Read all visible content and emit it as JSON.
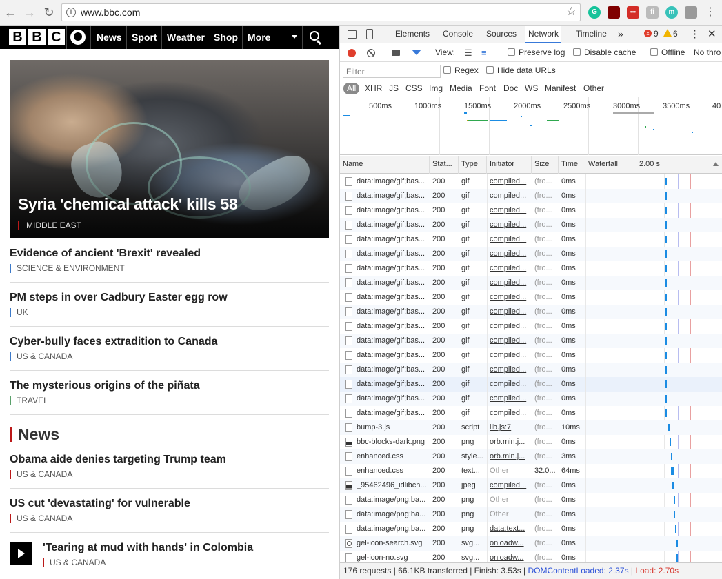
{
  "browser": {
    "url": "www.bbc.com",
    "extensions": [
      "grammarly-icon",
      "ublock-icon",
      "lastpass-icon",
      "extension-icon",
      "momentum-icon",
      "cube-icon"
    ],
    "ext_labels": [
      "G",
      "",
      "•••",
      "fi",
      "m",
      ""
    ]
  },
  "bbc": {
    "nav": [
      "News",
      "Sport",
      "Weather",
      "Shop",
      "More"
    ],
    "hero": {
      "title": "Syria 'chemical attack' kills 58",
      "tag": "MIDDLE EAST"
    },
    "stories": [
      {
        "title": "Evidence of ancient 'Brexit' revealed",
        "tag": "SCIENCE & ENVIRONMENT",
        "color": "#3d7ac9"
      },
      {
        "title": "PM steps in over Cadbury Easter egg row",
        "tag": "UK",
        "color": "#3d7ac9"
      },
      {
        "title": "Cyber-bully faces extradition to Canada",
        "tag": "US & CANADA",
        "color": "#3d7ac9"
      },
      {
        "title": "The mysterious origins of the piñata",
        "tag": "TRAVEL",
        "color": "#5aa06a"
      }
    ],
    "section": "News",
    "news_stories": [
      {
        "title": "Obama aide denies targeting Trump team",
        "tag": "US & CANADA"
      },
      {
        "title": "US cut 'devastating' for vulnerable",
        "tag": "US & CANADA"
      },
      {
        "title": "'Tearing at mud with hands' in Colombia",
        "tag": "US & CANADA"
      }
    ]
  },
  "devtools": {
    "tabs": [
      "Elements",
      "Console",
      "Sources",
      "Network",
      "Timeline"
    ],
    "active_tab": "Network",
    "more": "»",
    "errors": "9",
    "warnings": "6",
    "toolbar": {
      "view": "View:",
      "preserve_log": "Preserve log",
      "disable_cache": "Disable cache",
      "offline": "Offline",
      "throttle": "No thro"
    },
    "filter": {
      "placeholder": "Filter",
      "regex": "Regex",
      "hide_data_urls": "Hide data URLs"
    },
    "types": [
      "All",
      "XHR",
      "JS",
      "CSS",
      "Img",
      "Media",
      "Font",
      "Doc",
      "WS",
      "Manifest",
      "Other"
    ],
    "overview_ticks": [
      "500ms",
      "1000ms",
      "1500ms",
      "2000ms",
      "2500ms",
      "3000ms",
      "3500ms",
      "40"
    ],
    "columns": [
      "Name",
      "Stat...",
      "Type",
      "Initiator",
      "Size",
      "Time",
      "Waterfall",
      "2.00 s"
    ],
    "rows": [
      [
        "data:image/gif;bas...",
        "200",
        "gif",
        "compiled...",
        "(fro...",
        "0ms",
        "blank",
        0.58
      ],
      [
        "data:image/gif;bas...",
        "200",
        "gif",
        "compiled...",
        "(fro...",
        "0ms",
        "blank",
        0.58
      ],
      [
        "data:image/gif;bas...",
        "200",
        "gif",
        "compiled...",
        "(fro...",
        "0ms",
        "blank",
        0.58
      ],
      [
        "data:image/gif;bas...",
        "200",
        "gif",
        "compiled...",
        "(fro...",
        "0ms",
        "blank",
        0.58
      ],
      [
        "data:image/gif;bas...",
        "200",
        "gif",
        "compiled...",
        "(fro...",
        "0ms",
        "blank",
        0.58
      ],
      [
        "data:image/gif;bas...",
        "200",
        "gif",
        "compiled...",
        "(fro...",
        "0ms",
        "blank",
        0.58
      ],
      [
        "data:image/gif;bas...",
        "200",
        "gif",
        "compiled...",
        "(fro...",
        "0ms",
        "blank",
        0.58
      ],
      [
        "data:image/gif;bas...",
        "200",
        "gif",
        "compiled...",
        "(fro...",
        "0ms",
        "blank",
        0.58
      ],
      [
        "data:image/gif;bas...",
        "200",
        "gif",
        "compiled...",
        "(fro...",
        "0ms",
        "blank",
        0.58
      ],
      [
        "data:image/gif;bas...",
        "200",
        "gif",
        "compiled...",
        "(fro...",
        "0ms",
        "blank",
        0.58
      ],
      [
        "data:image/gif;bas...",
        "200",
        "gif",
        "compiled...",
        "(fro...",
        "0ms",
        "blank",
        0.58
      ],
      [
        "data:image/gif;bas...",
        "200",
        "gif",
        "compiled...",
        "(fro...",
        "0ms",
        "blank",
        0.58
      ],
      [
        "data:image/gif;bas...",
        "200",
        "gif",
        "compiled...",
        "(fro...",
        "0ms",
        "blank",
        0.58
      ],
      [
        "data:image/gif;bas...",
        "200",
        "gif",
        "compiled...",
        "(fro...",
        "0ms",
        "blank",
        0.58
      ],
      [
        "data:image/gif;bas...",
        "200",
        "gif",
        "compiled...",
        "(fro...",
        "0ms",
        "blank",
        0.58
      ],
      [
        "data:image/gif;bas...",
        "200",
        "gif",
        "compiled...",
        "(fro...",
        "0ms",
        "blank",
        0.58
      ],
      [
        "data:image/gif;bas...",
        "200",
        "gif",
        "compiled...",
        "(fro...",
        "0ms",
        "blank",
        0.58
      ],
      [
        "bump-3.js",
        "200",
        "script",
        "lib.js:7",
        "(fro...",
        "10ms",
        "blank",
        0.6
      ],
      [
        "bbc-blocks-dark.png",
        "200",
        "png",
        "orb.min.j...",
        "(fro...",
        "0ms",
        "img",
        0.61
      ],
      [
        "enhanced.css",
        "200",
        "style...",
        "orb.min.j...",
        "(fro...",
        "3ms",
        "blank",
        0.62
      ],
      [
        "enhanced.css",
        "200",
        "text...",
        "Other",
        "32.0...",
        "64ms",
        "blank",
        0.62
      ],
      [
        "_95462496_idlibch...",
        "200",
        "jpeg",
        "compiled...",
        "(fro...",
        "0ms",
        "img",
        0.63
      ],
      [
        "data:image/png;ba...",
        "200",
        "png",
        "Other",
        "(fro...",
        "0ms",
        "blank",
        0.64
      ],
      [
        "data:image/png;ba...",
        "200",
        "png",
        "Other",
        "(fro...",
        "0ms",
        "blank",
        0.64
      ],
      [
        "data:image/png;ba...",
        "200",
        "png",
        "data:text...",
        "(fro...",
        "0ms",
        "blank",
        0.65
      ],
      [
        "gel-icon-search.svg",
        "200",
        "svg...",
        "onloadw...",
        "(fro...",
        "0ms",
        "search",
        0.66
      ],
      [
        "gel-icon-no.svg",
        "200",
        "svg...",
        "onloadw...",
        "(fro...",
        "0ms",
        "blank",
        0.66
      ]
    ],
    "status": {
      "summary": "176 requests | 66.1KB transferred | Finish: 3.53s | ",
      "dom_content_loaded": "DOMContentLoaded: 2.37s",
      "separator": " | ",
      "load": "Load: 2.70s"
    }
  }
}
